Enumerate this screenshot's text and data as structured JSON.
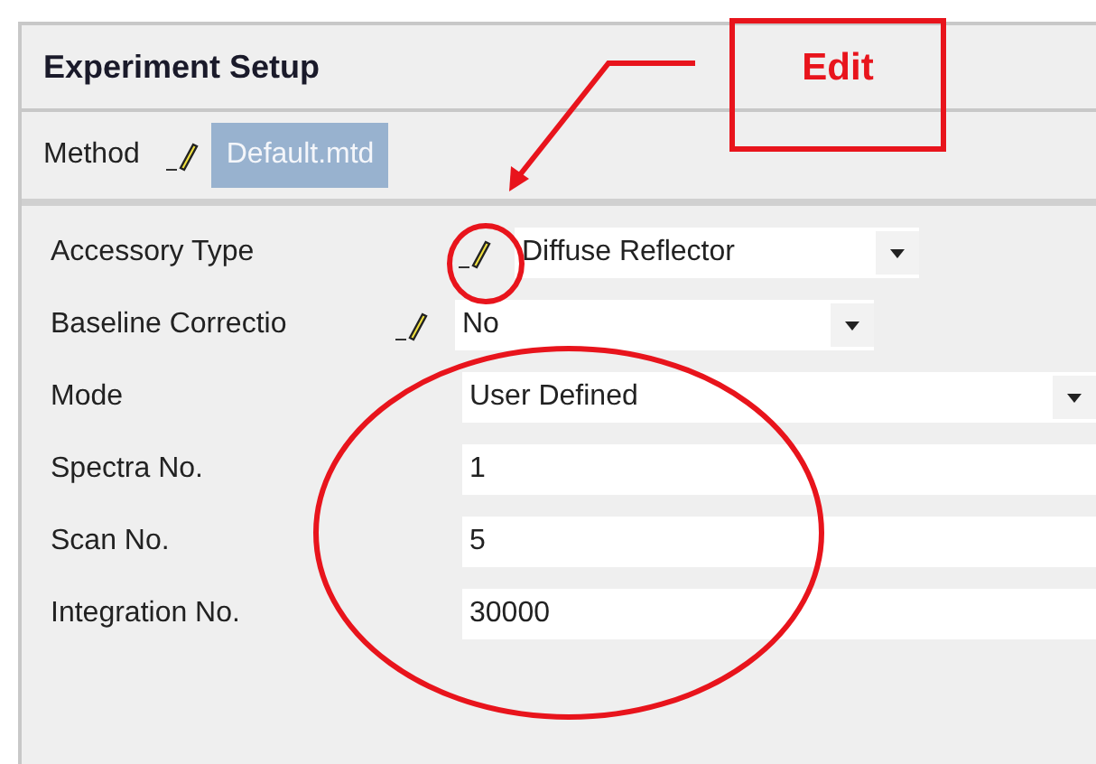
{
  "panel": {
    "title": "Experiment Setup"
  },
  "method": {
    "label": "Method",
    "value": "Default.mtd",
    "selected": true
  },
  "fields": [
    {
      "label": "Accessory Type",
      "kind": "dropdown",
      "editable": true,
      "value": "Diffuse Reflector"
    },
    {
      "label": "Baseline Correctio",
      "kind": "dropdown",
      "editable": true,
      "value": "No"
    },
    {
      "label": "Mode",
      "kind": "dropdown",
      "editable": false,
      "value": "User Defined"
    },
    {
      "label": "Spectra No.",
      "kind": "text",
      "editable": false,
      "value": "1"
    },
    {
      "label": "Scan No.",
      "kind": "text",
      "editable": false,
      "value": "5"
    },
    {
      "label": "Integration No.",
      "kind": "text",
      "editable": false,
      "value": "30000"
    }
  ],
  "annotation": {
    "label": "Edit"
  }
}
